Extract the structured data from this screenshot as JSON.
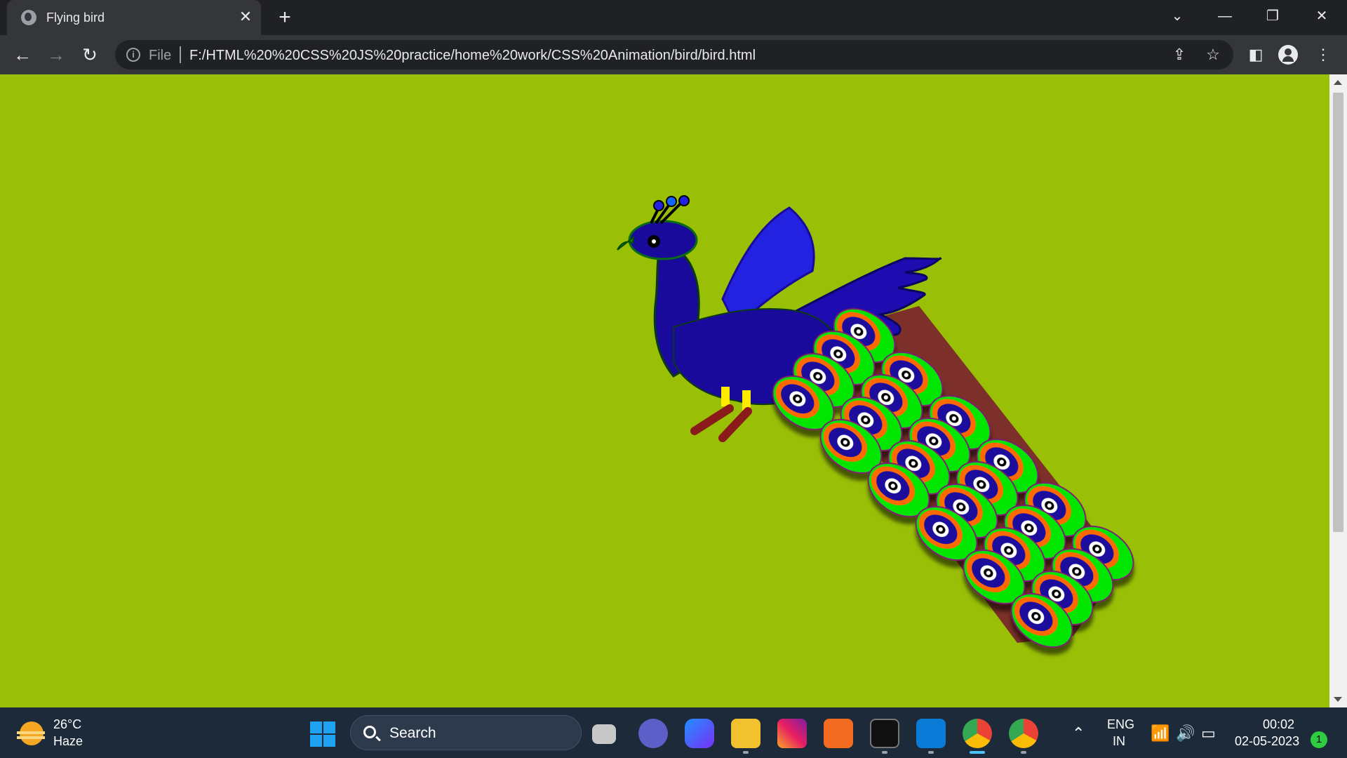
{
  "browser": {
    "tab_title": "Flying bird",
    "tab_close": "✕",
    "new_tab": "+",
    "file_label": "File",
    "url": "F:/HTML%20%20CSS%20JS%20practice/home%20work/CSS%20Animation/bird/bird.html",
    "icons": [
      "globe-icon",
      "back-icon",
      "forward-icon",
      "reload-icon",
      "info-icon",
      "share-icon",
      "star-icon",
      "side-panel-icon",
      "profile-icon",
      "menu-icon"
    ]
  },
  "page": {
    "background_color": "#99bf06",
    "colors": {
      "body": "#1a0a9c",
      "wing": "#1a0a9c",
      "feather_outer": "#00e600",
      "feather_ring": "#ff6a00",
      "feather_inner": "#1a0a9c",
      "legs": "#ffea00",
      "perch": "#8b1a1a"
    }
  },
  "taskbar": {
    "weather_temp": "26°C",
    "weather_desc": "Haze",
    "search_text": "Search",
    "lang_top": "ENG",
    "lang_bottom": "IN",
    "time": "00:02",
    "date": "02-05-2023",
    "notification_count": "1"
  }
}
